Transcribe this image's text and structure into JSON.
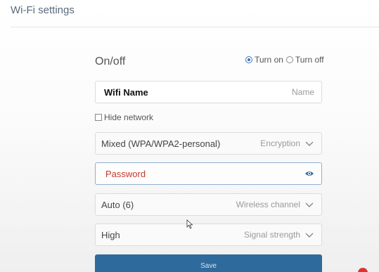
{
  "header": {
    "title": "Wi-Fi settings"
  },
  "onoff": {
    "label": "On/off",
    "options": [
      "Turn on",
      "Turn off"
    ],
    "selected": "Turn on"
  },
  "name_field": {
    "value": "Wifi Name",
    "hint": "Name"
  },
  "hide_network": {
    "label": "Hide network",
    "checked": false
  },
  "encryption": {
    "value": "Mixed (WPA/WPA2-personal)",
    "hint": "Encryption",
    "icon": "chevron-down-icon"
  },
  "password": {
    "value": "Password",
    "icon": "eye-icon"
  },
  "channel": {
    "value": "Auto (6)",
    "hint": "Wireless channel",
    "icon": "chevron-down-icon"
  },
  "signal": {
    "value": "High",
    "hint": "Signal strength",
    "icon": "chevron-down-icon"
  },
  "save": {
    "label": "Save"
  },
  "colors": {
    "accent": "#3a73b8",
    "save_button": "#2f6a9c",
    "password_text": "#c0392b"
  }
}
